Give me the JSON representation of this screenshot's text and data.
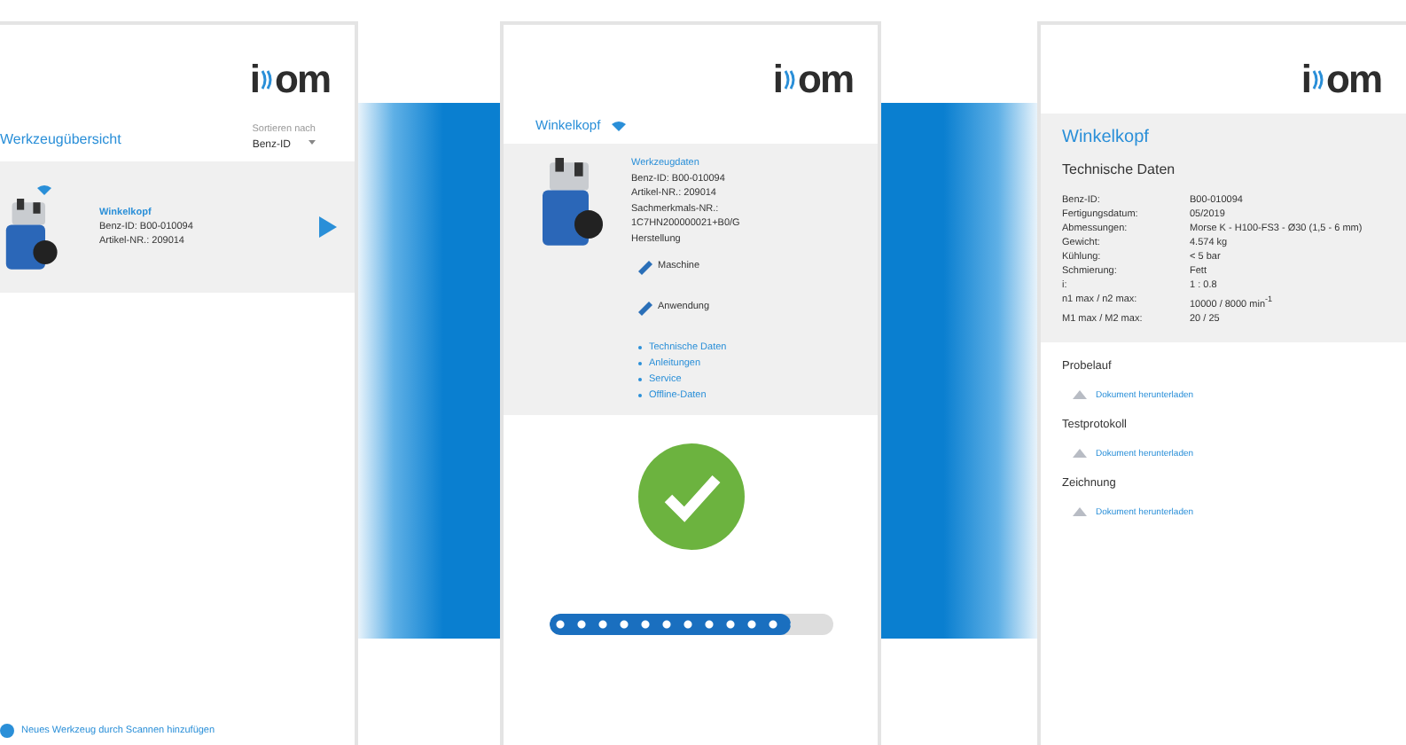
{
  "overview": {
    "logo": {
      "prefix": "i",
      "suffix": "om"
    },
    "title": "Werkzeugübersicht",
    "sort_label": "Sortieren nach",
    "sort_value": "Benz-ID",
    "tools": [
      {
        "name": "Winkelkopf",
        "lines": [
          "Benz-ID: B00-010094",
          "Artikel-NR.: 209014"
        ],
        "connected": true
      }
    ],
    "add_link": "Neues Werkzeug durch Scannen hinzufügen"
  },
  "detail": {
    "logo": {
      "prefix": "i",
      "suffix": "om"
    },
    "title": "Winkelkopf",
    "connected": true,
    "section": "Werkzeugdaten",
    "lines": [
      "Benz-ID: B00-010094",
      "Artikel-NR.: 209014",
      "Sachmerkmals-NR.:",
      "1C7HN200000021+B0/G",
      "Herstellung"
    ],
    "edit_items": [
      "Maschine",
      "Anwendung"
    ],
    "links": [
      "Technische Daten",
      "Anleitungen",
      "Service",
      "Offline-Daten"
    ],
    "progress": {
      "level": 0.85
    }
  },
  "tech": {
    "logo": {
      "prefix": "i",
      "suffix": "om"
    },
    "title": "Winkelkopf",
    "subtitle": "Technische Daten",
    "rows": [
      {
        "key": "Benz-ID:",
        "value": "B00-010094"
      },
      {
        "key": "Fertigungsdatum:",
        "value": "05/2019"
      },
      {
        "key": "Abmessungen:",
        "value": "Morse K - H100-FS3 - Ø30 (1,5 - 6 mm)"
      },
      {
        "key": "Gewicht:",
        "value": "4.574 kg"
      },
      {
        "key": "Kühlung:",
        "value": "< 5 bar"
      },
      {
        "key": "Schmierung:",
        "value": "Fett"
      },
      {
        "key": "i:",
        "value": "1 : 0.8"
      },
      {
        "key": "n1 max / n2 max:",
        "value": "10000 / 8000 min$^{-1}$"
      },
      {
        "key": "M1 max / M2 max:",
        "value": "20 / 25"
      }
    ],
    "documents": [
      {
        "heading": "Probelauf",
        "link": "Dokument herunterladen"
      },
      {
        "heading": "Testprotokoll",
        "link": "Dokument herunterladen"
      },
      {
        "heading": "Zeichnung",
        "link": "Dokument herunterladen"
      }
    ]
  }
}
